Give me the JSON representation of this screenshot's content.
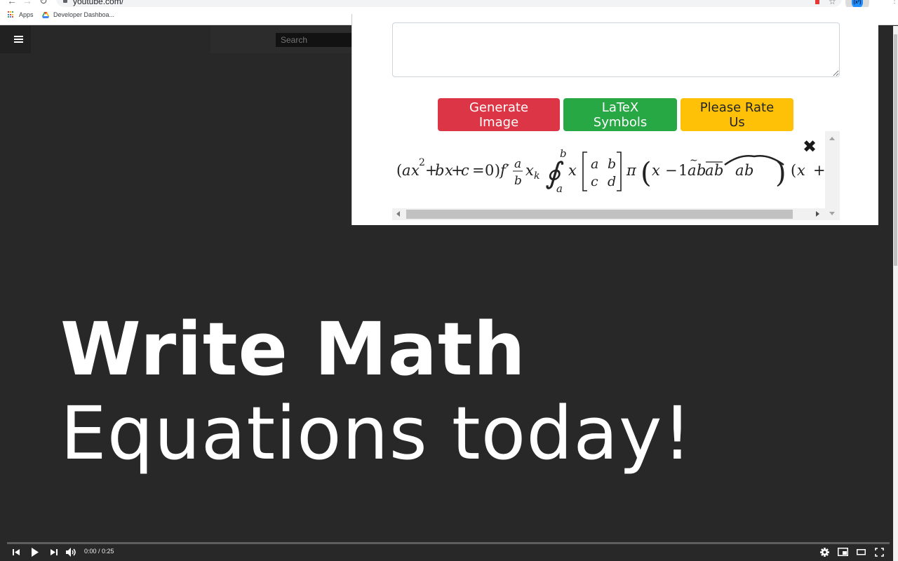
{
  "browser": {
    "url": "youtube.com/",
    "bookmarks": [
      {
        "label": "Apps",
        "icon": "apps-grid-icon"
      },
      {
        "label": "Developer Dashboa...",
        "icon": "drive-icon"
      }
    ],
    "extension_badge": "(x²)"
  },
  "youtube": {
    "search_placeholder": "Search",
    "video_title_line1": "Write Math",
    "video_title_line2": "Equations today!",
    "player": {
      "time_display": "0:00 / 0:25",
      "progress_percent": 0,
      "controls": [
        "previous",
        "play",
        "next",
        "volume",
        "settings",
        "miniplayer",
        "theater-mode",
        "fullscreen"
      ]
    }
  },
  "extension_popup": {
    "latex_input_value": "",
    "buttons": {
      "generate": "Generate Image",
      "symbols": "LaTeX Symbols",
      "rate": "Please Rate Us"
    },
    "colors": {
      "generate": "#dc3545",
      "symbols": "#28a745",
      "rate": "#ffc107"
    },
    "close_label": "✖",
    "rendered_equation": "(ax²+bx+c = 0)f′ a/b x_k ∮_a^b x [a b; c d] π (x − 1 ãb̃ a̅b̅ âb) (x +"
  }
}
